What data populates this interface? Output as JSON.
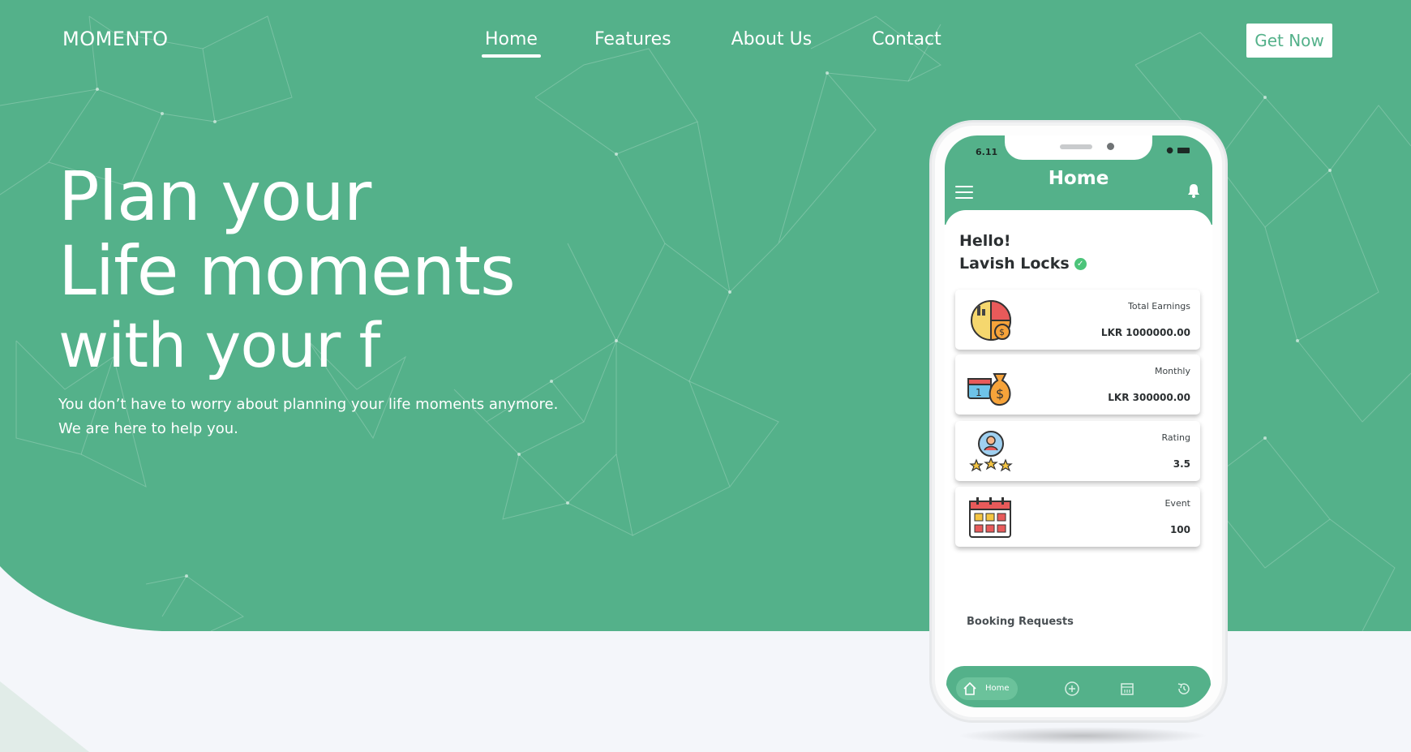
{
  "brand": {
    "logo": "MOMENTO"
  },
  "nav": {
    "items": [
      {
        "label": "Home",
        "active": true
      },
      {
        "label": "Features",
        "active": false
      },
      {
        "label": "About Us",
        "active": false
      },
      {
        "label": "Contact",
        "active": false
      }
    ],
    "cta_label": "Get Now"
  },
  "hero": {
    "line1": "Plan your",
    "line2": "Life moments",
    "line3": "with your f",
    "sub1": "You don’t have to worry about planning your life moments anymore.",
    "sub2": "We are here to help you."
  },
  "phone": {
    "time": "6.11",
    "title": "Home",
    "greeting": "Hello!",
    "user_name": "Lavish  Locks",
    "stats": [
      {
        "label": "Total Earnings",
        "value": "LKR 1000000.00",
        "icon": "earnings-chart-icon"
      },
      {
        "label": "Monthly",
        "value": "LKR 300000.00",
        "icon": "money-bag-calendar-icon"
      },
      {
        "label": "Rating",
        "value": "3.5",
        "icon": "user-rating-stars-icon"
      },
      {
        "label": "Event",
        "value": "100",
        "icon": "calendar-event-icon"
      }
    ],
    "section_title": "Booking Requests",
    "tabbar": {
      "home_label": "Home",
      "tabs": [
        "home-icon",
        "plus-circle-icon",
        "calendar-icon",
        "history-icon"
      ]
    }
  },
  "colors": {
    "primary": "#54b18a",
    "background": "#f4f6fa",
    "white": "#ffffff"
  }
}
